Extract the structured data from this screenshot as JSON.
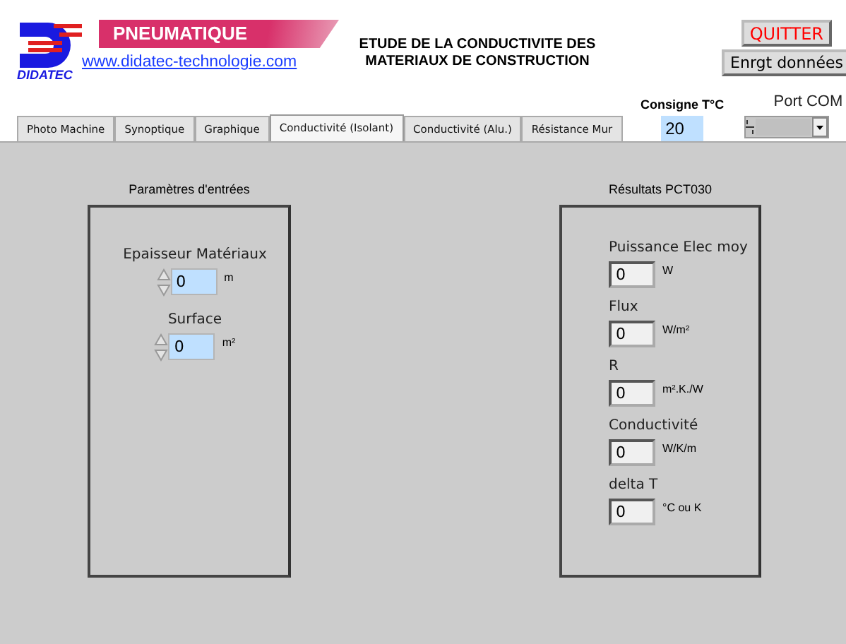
{
  "header": {
    "brand": "DIDATEC",
    "banner": "PNEUMATIQUE",
    "link": "www.didatec-technologie.com",
    "title": [
      "ETUDE DE LA CONDUCTIVITE DES",
      "MATERIAUX DE CONSTRUCTION"
    ]
  },
  "buttons": [
    {
      "label": "QUITTER",
      "kind": "danger"
    },
    {
      "label": "Enrgt données",
      "kind": "normal"
    }
  ],
  "setpoint": {
    "label": "Consigne T°C",
    "value": "20"
  },
  "port": {
    "label": "Port COM"
  },
  "tabs": [
    {
      "label": "Photo Machine",
      "selected": false
    },
    {
      "label": "Synoptique",
      "selected": false
    },
    {
      "label": "Graphique",
      "selected": false
    },
    {
      "label": "Conductivité (Isolant)",
      "selected": true
    },
    {
      "label": "Conductivité (Alu.)",
      "selected": false
    },
    {
      "label": "Résistance Mur",
      "selected": false
    }
  ],
  "inputs": {
    "title": "Paramètres d'entrées",
    "fields": [
      {
        "label": "Epaisseur Matériaux",
        "value": "0",
        "unit": "m"
      },
      {
        "label": "Surface",
        "value": "0",
        "unit": "m²"
      }
    ]
  },
  "results": {
    "title": "Résultats PCT030",
    "fields": [
      {
        "label": "Puissance Elec moy",
        "value": "0",
        "unit": "W"
      },
      {
        "label": "Flux",
        "value": "0",
        "unit": "W/m²"
      },
      {
        "label": "R",
        "value": "0",
        "unit": "m².K./W"
      },
      {
        "label": "Conductivité",
        "value": "0",
        "unit": "W/K/m"
      },
      {
        "label": "delta T",
        "value": "0",
        "unit": "°C ou K"
      }
    ]
  }
}
